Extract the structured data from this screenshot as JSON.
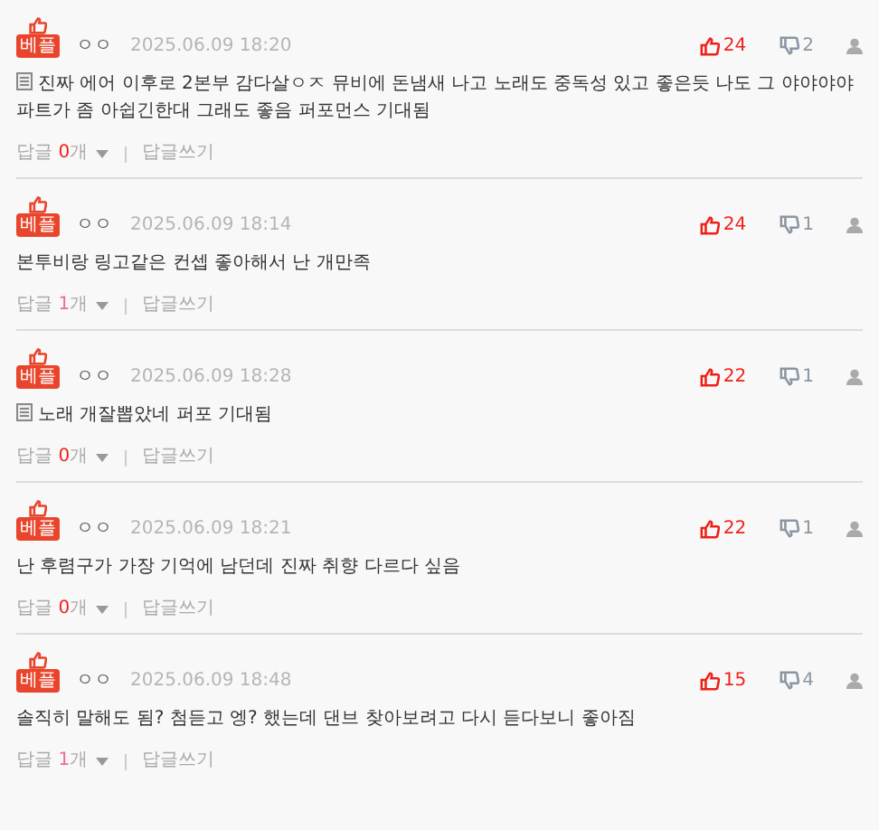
{
  "comments": [
    {
      "badge": "베플",
      "author": "ㅇㅇ",
      "date": "2025.06.09 18:20",
      "likes": "24",
      "dislikes": "2",
      "attachment": true,
      "text": "진짜 에어 이후로 2본부 감다살ㅇㅈ 뮤비에 돈냄새 나고 노래도 중독성 있고 좋은듯 나도 그 야야야야 파트가 좀 아쉽긴한대 그래도 좋음 퍼포먼스 기대됨",
      "reply_label": "답글",
      "reply_count": "0",
      "reply_unit": "개",
      "write_label": "답글쓰기"
    },
    {
      "badge": "베플",
      "author": "ㅇㅇ",
      "date": "2025.06.09 18:14",
      "likes": "24",
      "dislikes": "1",
      "attachment": false,
      "text": "본투비랑 링고같은 컨셉 좋아해서 난 개만족",
      "reply_label": "답글",
      "reply_count": "1",
      "reply_unit": "개",
      "write_label": "답글쓰기"
    },
    {
      "badge": "베플",
      "author": "ㅇㅇ",
      "date": "2025.06.09 18:28",
      "likes": "22",
      "dislikes": "1",
      "attachment": true,
      "text": "노래 개잘뽑았네 퍼포 기대됨",
      "reply_label": "답글",
      "reply_count": "0",
      "reply_unit": "개",
      "write_label": "답글쓰기"
    },
    {
      "badge": "베플",
      "author": "ㅇㅇ",
      "date": "2025.06.09 18:21",
      "likes": "22",
      "dislikes": "1",
      "attachment": false,
      "text": "난 후렴구가 가장 기억에 남던데 진짜 취향 다르다 싶음",
      "reply_label": "답글",
      "reply_count": "0",
      "reply_unit": "개",
      "write_label": "답글쓰기"
    },
    {
      "badge": "베플",
      "author": "ㅇㅇ",
      "date": "2025.06.09 18:48",
      "likes": "15",
      "dislikes": "4",
      "attachment": false,
      "text": "솔직히 말해도 됨? 첨듣고 엥? 했는데 댄브 찾아보려고 다시 듣다보니 좋아짐",
      "reply_label": "답글",
      "reply_count": "1",
      "reply_unit": "개",
      "write_label": "답글쓰기"
    }
  ]
}
